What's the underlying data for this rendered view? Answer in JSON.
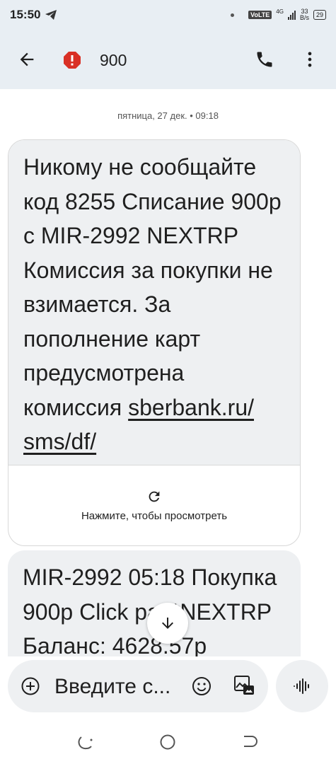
{
  "status_bar": {
    "time": "15:50",
    "network": "VoLTE",
    "net_gen": "4G",
    "speed_value": "33",
    "speed_unit": "B/s",
    "battery": "29"
  },
  "header": {
    "title": "900",
    "icons": {
      "back": "arrow-left-icon",
      "alert": "spam-alert-icon",
      "call": "phone-icon",
      "menu": "more-vert-icon"
    }
  },
  "conversation": {
    "date_separator": "пятница, 27 дек. • 09:18",
    "messages": [
      {
        "text": "Никому не сообщайте код 8255 Списание 900р с MIR-2992 NEXTRP Комиссия за покупки не взимается. За пополнение карт предусмотрена комиссия ",
        "link": "sberbank.ru/ sms/df/",
        "preview_label": "Нажмите, чтобы просмотреть"
      },
      {
        "text": "MIR-2992 05:18 Покупка 900р Click pay*NEXTRP Баланс: 4628.57р"
      }
    ]
  },
  "composer": {
    "placeholder": "Введите с...",
    "icons": {
      "attach": "add-circle-icon",
      "emoji": "emoji-icon",
      "gallery": "gallery-icon",
      "voice": "voice-record-icon"
    }
  },
  "colors": {
    "app_bar": "#e8eef3",
    "bubble": "#eef0f2",
    "alert": "#d93025"
  }
}
